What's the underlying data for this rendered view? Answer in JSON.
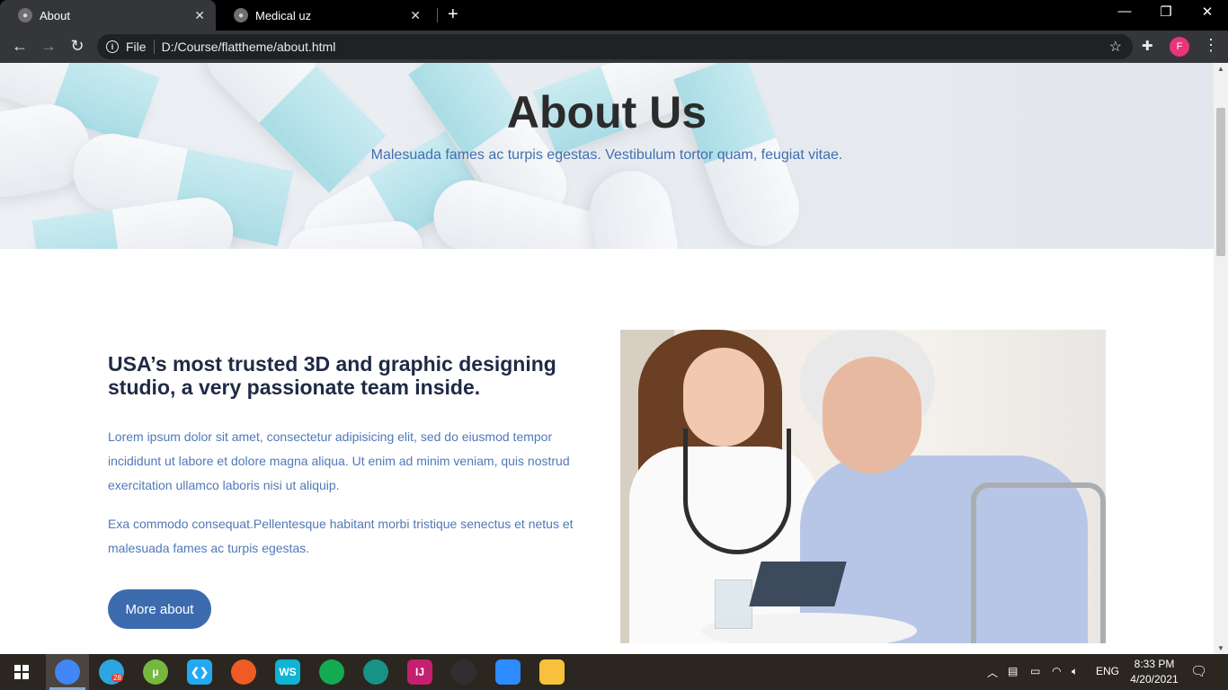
{
  "browser": {
    "tabs": [
      {
        "title": "About",
        "active": true
      },
      {
        "title": "Medical uz",
        "active": false
      }
    ],
    "new_tab_glyph": "+",
    "window_controls": {
      "minimize": "—",
      "restore": "❐",
      "close": "✕"
    },
    "address": {
      "scheme_label": "File",
      "url": "D:/Course/flattheme/about.html"
    },
    "profile_initial": "F"
  },
  "hero": {
    "title": "About Us",
    "subtitle": "Malesuada fames ac turpis egestas. Vestibulum tortor quam, feugiat vitae."
  },
  "about": {
    "heading": "USA’s most trusted 3D and graphic designing studio, a very passionate team inside.",
    "paragraph1": "Lorem ipsum dolor sit amet, consectetur adipisicing elit, sed do eiusmod tempor incididunt ut labore et dolore magna aliqua. Ut enim ad minim veniam, quis nostrud exercitation ullamco laboris nisi ut aliquip.",
    "paragraph2": "Exa commodo consequat.Pellentesque habitant morbi tristique senectus et netus et malesuada fames ac turpis egestas.",
    "button_label": "More about"
  },
  "taskbar": {
    "apps": [
      {
        "name": "chrome-icon",
        "color": "#4285f4"
      },
      {
        "name": "telegram-icon",
        "color": "#2ca5e0",
        "badge": "28"
      },
      {
        "name": "utorrent-icon",
        "color": "#76b83f",
        "glyph": "µ"
      },
      {
        "name": "vscode-icon",
        "color": "#23a9f2",
        "glyph": "❮❯"
      },
      {
        "name": "postman-icon",
        "color": "#ef5b25"
      },
      {
        "name": "webstorm-icon",
        "color": "#0fb3d3",
        "glyph": "WS"
      },
      {
        "name": "mongodb-compass-icon",
        "color": "#13aa52"
      },
      {
        "name": "gitkraken-icon",
        "color": "#179287"
      },
      {
        "name": "intellij-icon",
        "color": "#c51f6f",
        "glyph": "IJ"
      },
      {
        "name": "obs-icon",
        "color": "#302e31"
      },
      {
        "name": "zoom-icon",
        "color": "#2d8cff"
      },
      {
        "name": "file-explorer-icon",
        "color": "#f8c13b"
      }
    ],
    "language": "ENG",
    "time": "8:33 PM",
    "date": "4/20/2021"
  }
}
